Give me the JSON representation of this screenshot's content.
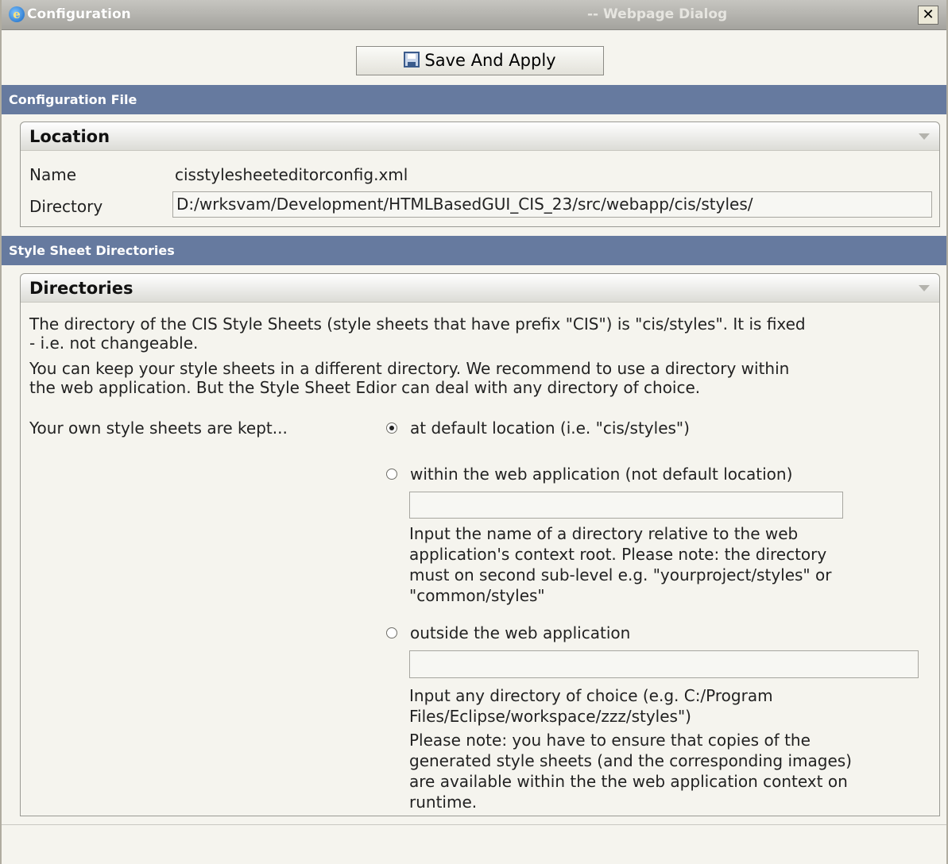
{
  "window": {
    "title": "Configuration",
    "subtitle": "-- Webpage Dialog",
    "close_label": "✕"
  },
  "toolbar": {
    "save_label": "Save And Apply"
  },
  "config_section": {
    "title": "Configuration File",
    "location_panel": {
      "title": "Location",
      "name_label": "Name",
      "name_value": "cisstylesheeteditorconfig.xml",
      "directory_label": "Directory",
      "directory_value": "D:/wrksvam/Development/HTMLBasedGUI_CIS_23/src/webapp/cis/styles/"
    }
  },
  "stylesheet_section": {
    "title": "Style Sheet Directories",
    "directories_panel": {
      "title": "Directories",
      "para1_line1": "The directory of the CIS Style Sheets (style sheets that have prefix \"CIS\") is \"cis/styles\". It is fixed",
      "para1_line2": "- i.e. not changeable.",
      "para2_line1": "You can keep your style sheets in a different directory. We recommend to use a directory within",
      "para2_line2": "the web application. But the Style Sheet Edior can deal with any directory of choice.",
      "kept_label": "Your own style sheets are kept...",
      "options": [
        {
          "label": "at default location (i.e. \"cis/styles\")",
          "checked": true
        },
        {
          "label": "within the web application (not default location)",
          "checked": false,
          "input_value": "",
          "hint_lines": [
            "Input the name of a directory relative to the web",
            "application's context root. Please note: the directory",
            "must on second sub-level e.g. \"yourproject/styles\" or",
            "\"common/styles\""
          ]
        },
        {
          "label": "outside the web application",
          "checked": false,
          "input_value": "",
          "hint_lines": [
            "Input any directory of choice (e.g. C:/Program",
            "Files/Eclipse/workspace/zzz/styles\")"
          ],
          "note_lines": [
            "Please note: you have to ensure that copies of the",
            "generated style sheets (and the corresponding images)",
            "are available within the the web application context on",
            "runtime."
          ]
        }
      ]
    }
  }
}
